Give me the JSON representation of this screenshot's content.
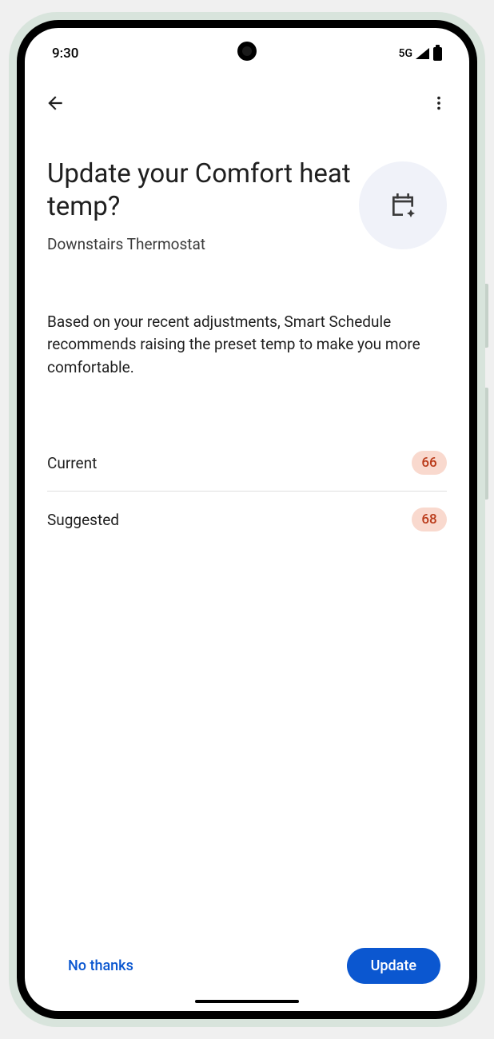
{
  "statusBar": {
    "time": "9:30",
    "network": "5G"
  },
  "header": {
    "title": "Update your Comfort heat temp?",
    "subtitle": "Downstairs Thermostat"
  },
  "description": "Based on your recent adjustments, Smart Schedule recommends raising the preset temp to make you more comfortable.",
  "temps": {
    "currentLabel": "Current",
    "currentValue": "66",
    "suggestedLabel": "Suggested",
    "suggestedValue": "68"
  },
  "buttons": {
    "secondary": "No thanks",
    "primary": "Update"
  },
  "colors": {
    "primary": "#0b57d0",
    "tempBadgeBg": "#f9d9ce",
    "tempBadgeText": "#ba3b1a"
  }
}
